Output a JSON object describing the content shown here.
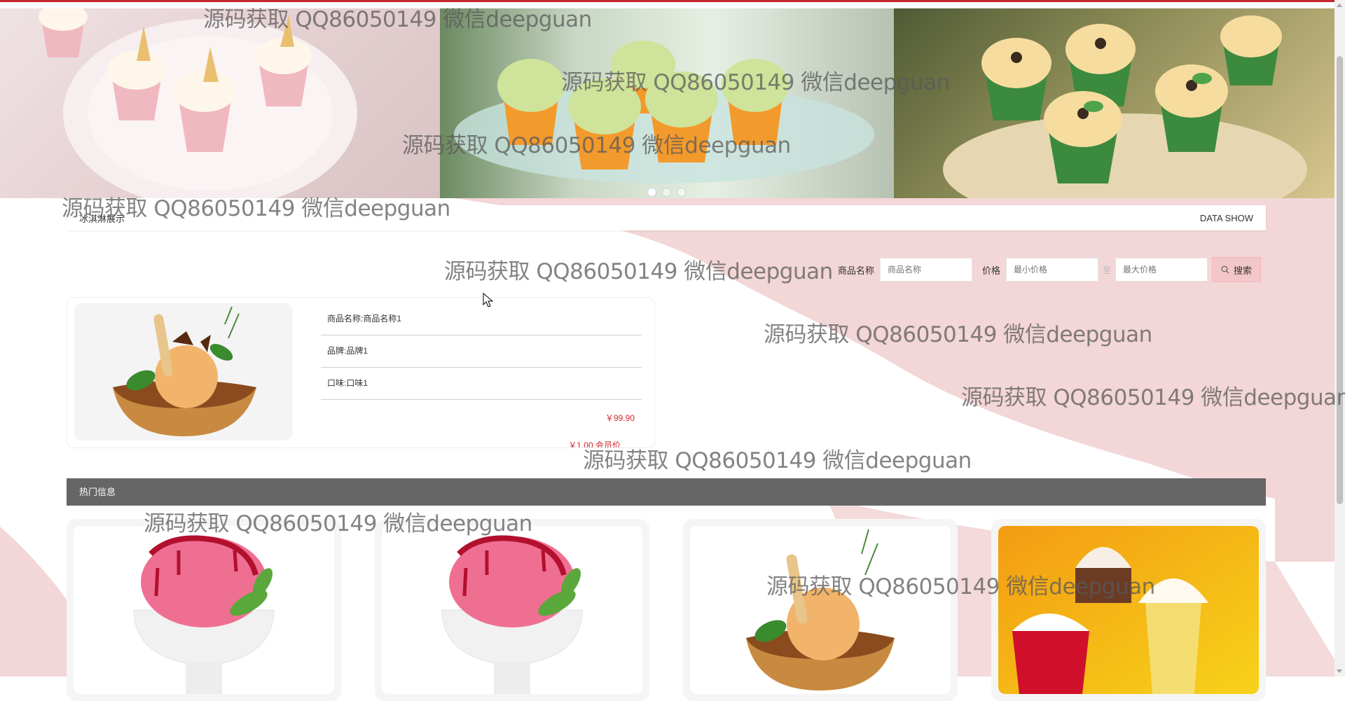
{
  "banner": {
    "slides": [
      "slide-1",
      "slide-2",
      "slide-3"
    ],
    "dots": 3,
    "active_dot": 0
  },
  "data_show": {
    "left_label": "冰淇淋展示",
    "right_label": "DATA SHOW"
  },
  "search": {
    "name_label": "商品名称",
    "name_placeholder": "商品名称",
    "price_label": "价格",
    "min_placeholder": "最小价格",
    "to_label": "至",
    "max_placeholder": "最大价格",
    "button_label": "搜索"
  },
  "product": {
    "name_row": "商品名称:商品名称1",
    "brand_row": "品牌:品牌1",
    "taste_row": "口味:口味1",
    "price": "￥99.90",
    "vip_price": "￥1.00 会员价"
  },
  "hot": {
    "title": "热门信息"
  },
  "watermarks": [
    "源码获取 QQ86050149 微信deepguan",
    "源码获取 QQ86050149 微信deepguan",
    "源码获取 QQ86050149 微信deepguan",
    "源码获取 QQ86050149 微信deepguan",
    "源码获取 QQ86050149 微信deepguan",
    "源码获取 QQ86050149 微信deepguan",
    "源码获取 QQ86050149 微信deepguan",
    "源码获取 QQ86050149 微信deepguan",
    "源码获取 QQ86050149 微信deepguan",
    "源码获取 QQ86050149 微信deepguan"
  ],
  "colors": {
    "accent_red": "#c0282d",
    "pink": "#f3d6d7",
    "price_red": "#d2232a",
    "hot_bar": "#666666"
  }
}
